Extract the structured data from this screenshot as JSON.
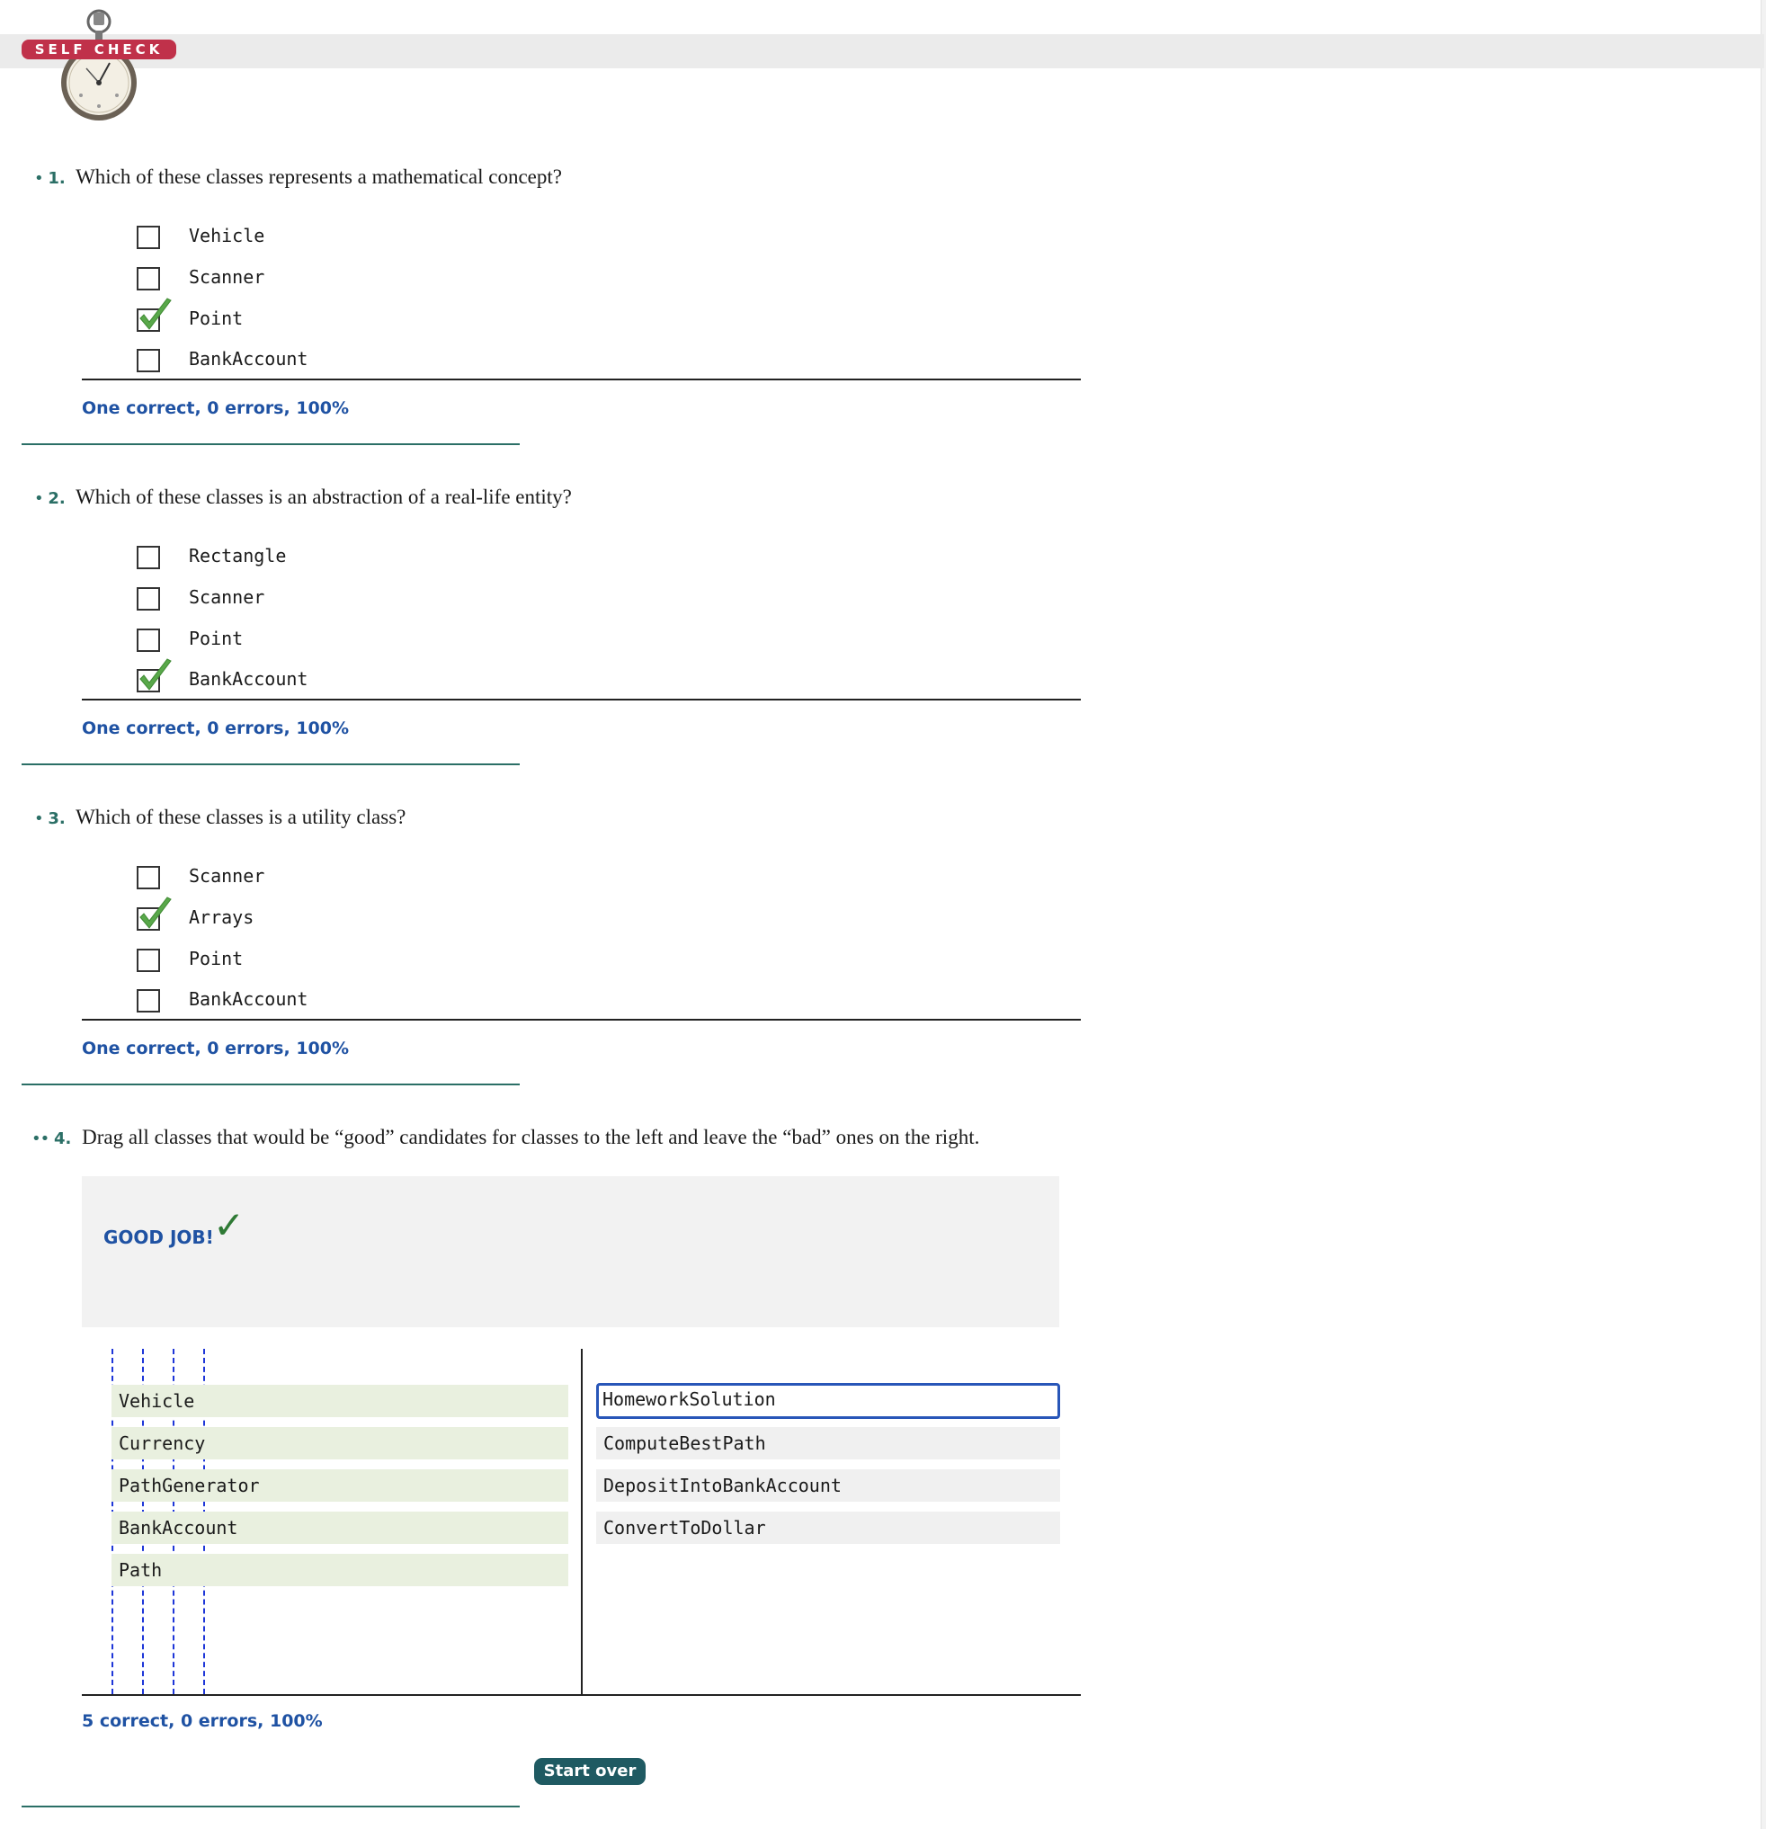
{
  "header": {
    "badge_label": "SELF CHECK"
  },
  "questions": [
    {
      "bullet": "•",
      "number": "1.",
      "text": "Which of these classes represents a mathematical concept?",
      "options": [
        {
          "label": "Vehicle",
          "checked": false
        },
        {
          "label": "Scanner",
          "checked": false
        },
        {
          "label": "Point",
          "checked": true
        },
        {
          "label": "BankAccount",
          "checked": false
        }
      ],
      "score": "One correct, 0 errors, 100%"
    },
    {
      "bullet": "•",
      "number": "2.",
      "text": "Which of these classes is an abstraction of a real-life entity?",
      "options": [
        {
          "label": "Rectangle",
          "checked": false
        },
        {
          "label": "Scanner",
          "checked": false
        },
        {
          "label": "Point",
          "checked": false
        },
        {
          "label": "BankAccount",
          "checked": true
        }
      ],
      "score": "One correct, 0 errors, 100%"
    },
    {
      "bullet": "•",
      "number": "3.",
      "text": "Which of these classes is a utility class?",
      "options": [
        {
          "label": "Scanner",
          "checked": false
        },
        {
          "label": "Arrays",
          "checked": true
        },
        {
          "label": "Point",
          "checked": false
        },
        {
          "label": "BankAccount",
          "checked": false
        }
      ],
      "score": "One correct, 0 errors, 100%"
    },
    {
      "bullet": "••",
      "number": "4.",
      "text": "Drag all classes that would be “good” candidates for classes to the left and leave the “bad” ones on the right.",
      "feedback": "GOOD JOB!",
      "feedback_icon": "✓",
      "good_items": [
        "Vehicle",
        "Currency",
        "PathGenerator",
        "BankAccount",
        "Path"
      ],
      "bad_items": [
        "HomeworkSolution",
        "ComputeBestPath",
        "DepositIntoBankAccount",
        "ConvertToDollar"
      ],
      "score": "5 correct, 0 errors, 100%",
      "start_over_label": "Start over"
    }
  ],
  "colors": {
    "accent_blue": "#1f52a3",
    "teal": "#2b6f66",
    "check_green": "#2f7a35",
    "badge_red": "#c0314a",
    "button": "#1f5a62"
  }
}
